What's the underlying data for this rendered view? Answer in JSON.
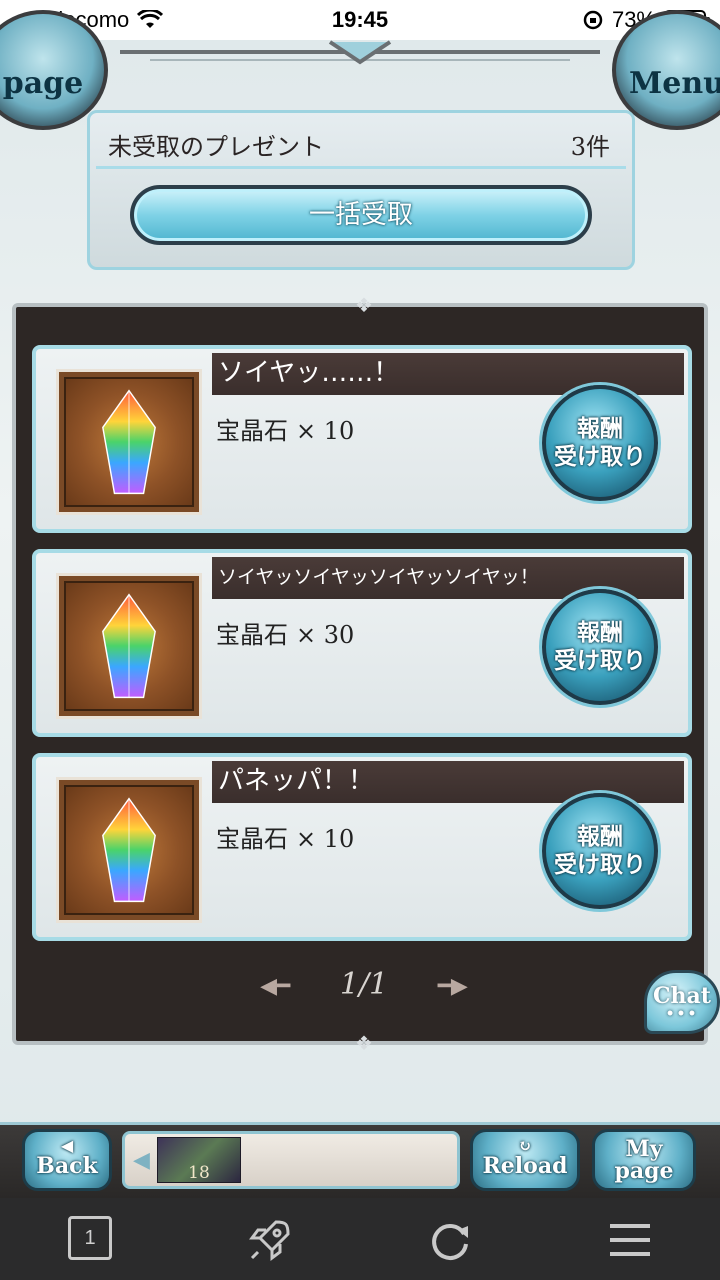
{
  "status_bar": {
    "carrier": "docomo",
    "time": "19:45",
    "battery_percent_label": "73%",
    "battery_level": 0.73
  },
  "header": {
    "left_disc_label": "page",
    "right_disc_label": "Menu"
  },
  "present_box": {
    "title": "未受取のプレゼント",
    "count": "3件",
    "bulk_button_label": "一括受取"
  },
  "gifts": [
    {
      "name": "ソイヤッ……！",
      "item": "宝晶石",
      "quantity": "× 10",
      "claim_line1": "報酬",
      "claim_line2": "受け取り"
    },
    {
      "name": "ソイヤッソイヤッソイヤッソイヤッ！",
      "item": "宝晶石",
      "quantity": "× 30",
      "claim_line1": "報酬",
      "claim_line2": "受け取り"
    },
    {
      "name": "パネッパ！！",
      "item": "宝晶石",
      "quantity": "× 10",
      "claim_line1": "報酬",
      "claim_line2": "受け取り"
    }
  ],
  "pager": {
    "label": "1/1"
  },
  "chat": {
    "label": "Chat"
  },
  "footer": {
    "back_label": "Back",
    "reload_label": "Reload",
    "mypage_line1": "My",
    "mypage_line2": "page",
    "thumbnail_count": "18"
  },
  "browser_bar": {
    "tab_count": "1"
  },
  "colors": {
    "accent_cyan": "#7fd2e6",
    "panel_dark": "#2d2725",
    "name_bar": "#3a2e2c"
  },
  "icons": [
    "signal-icon",
    "wifi-icon",
    "orientation-lock-icon",
    "battery-icon",
    "crystal-icon",
    "reload-icon",
    "rocket-icon",
    "refresh-icon",
    "menu-icon"
  ]
}
